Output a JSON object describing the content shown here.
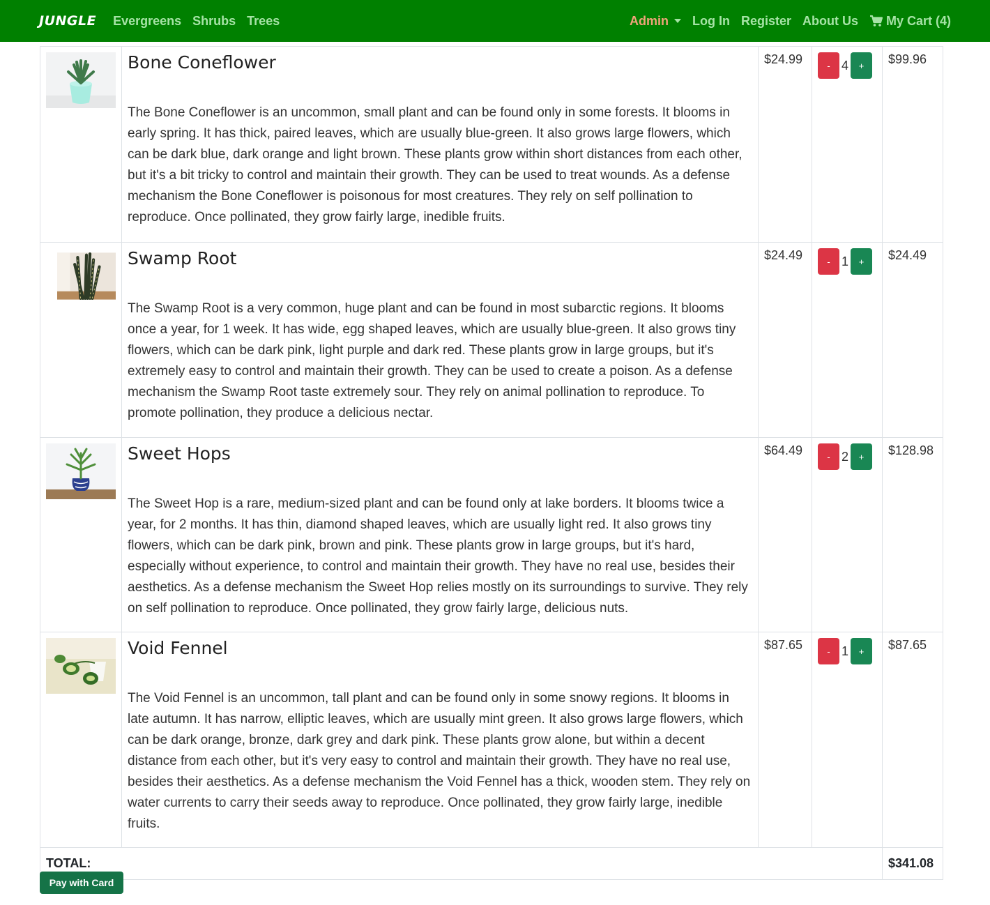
{
  "navbar": {
    "brand": "JUNGLE",
    "links": [
      "Evergreens",
      "Shrubs",
      "Trees"
    ],
    "admin": "Admin",
    "login": "Log In",
    "register": "Register",
    "about": "About Us",
    "cart": "My Cart (4)",
    "cart_icon": "shopping-cart-icon"
  },
  "colors": {
    "navbar_bg": "#008000",
    "nav_link": "#a6e3a6",
    "admin_link": "#f0a47a",
    "minus_button": "#dc3545",
    "plus_button": "#198754"
  },
  "items": [
    {
      "name": "Bone Coneflower",
      "description": "The Bone Coneflower is an uncommon, small plant and can be found only in some forests. It blooms in early spring. It has thick, paired leaves, which are usually blue-green. It also grows large flowers, which can be dark blue, dark orange and light brown. These plants grow within short distances from each other, but it's a bit tricky to control and maintain their growth. They can be used to treat wounds. As a defense mechanism the Bone Coneflower is poisonous for most creatures. They rely on self pollination to reproduce. Once pollinated, they grow fairly large, inedible fruits.",
      "price": "$24.99",
      "quantity": "4",
      "subtotal": "$99.96",
      "minus": "-",
      "plus": "+"
    },
    {
      "name": "Swamp Root",
      "description": "The Swamp Root is a very common, huge plant and can be found in most subarctic regions. It blooms once a year, for 1 week. It has wide, egg shaped leaves, which are usually blue-green. It also grows tiny flowers, which can be dark pink, light purple and dark red. These plants grow in large groups, but it's extremely easy to control and maintain their growth. They can be used to create a poison. As a defense mechanism the Swamp Root taste extremely sour. They rely on animal pollination to reproduce. To promote pollination, they produce a delicious nectar.",
      "price": "$24.49",
      "quantity": "1",
      "subtotal": "$24.49",
      "minus": "-",
      "plus": "+"
    },
    {
      "name": "Sweet Hops",
      "description": "The Sweet Hop is a rare, medium-sized plant and can be found only at lake borders. It blooms twice a year, for 2 months. It has thin, diamond shaped leaves, which are usually light red. It also grows tiny flowers, which can be dark pink, brown and pink. These plants grow in large groups, but it's hard, especially without experience, to control and maintain their growth. They have no real use, besides their aesthetics. As a defense mechanism the Sweet Hop relies mostly on its surroundings to survive. They rely on self pollination to reproduce. Once pollinated, they grow fairly large, delicious nuts.",
      "price": "$64.49",
      "quantity": "2",
      "subtotal": "$128.98",
      "minus": "-",
      "plus": "+"
    },
    {
      "name": "Void Fennel",
      "description": "The Void Fennel is an uncommon, tall plant and can be found only in some snowy regions. It blooms in late autumn. It has narrow, elliptic leaves, which are usually mint green. It also grows large flowers, which can be dark orange, bronze, dark grey and dark pink. These plants grow alone, but within a decent distance from each other, but it's very easy to control and maintain their growth. They have no real use, besides their aesthetics. As a defense mechanism the Void Fennel has a thick, wooden stem. They rely on water currents to carry their seeds away to reproduce. Once pollinated, they grow fairly large, inedible fruits.",
      "price": "$87.65",
      "quantity": "1",
      "subtotal": "$87.65",
      "minus": "-",
      "plus": "+"
    }
  ],
  "total": {
    "label": "TOTAL:",
    "value": "$341.08"
  },
  "pay_button": "Pay with Card"
}
